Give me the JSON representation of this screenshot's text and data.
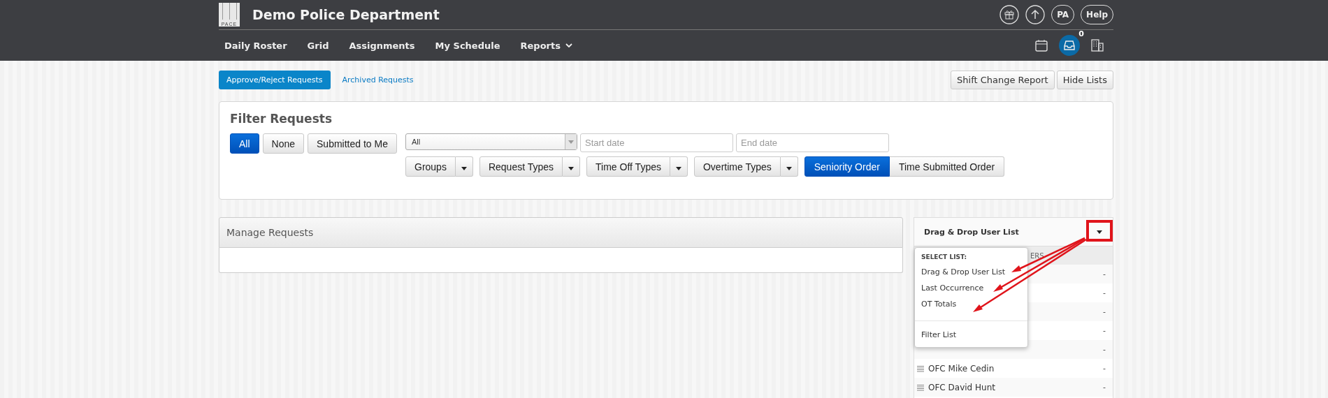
{
  "header": {
    "logo": "PACE",
    "title": "Demo Police Department",
    "circle_buttons": [
      {
        "kind": "gift"
      },
      {
        "kind": "upload"
      },
      {
        "kind": "text",
        "label": "PA"
      },
      {
        "kind": "text",
        "label": "Help"
      }
    ],
    "nav": [
      {
        "label": "Daily Roster",
        "has_menu": false
      },
      {
        "label": "Grid",
        "has_menu": false
      },
      {
        "label": "Assignments",
        "has_menu": false
      },
      {
        "label": "My Schedule",
        "has_menu": false
      },
      {
        "label": "Reports",
        "has_menu": true
      }
    ],
    "nav_icons": [
      {
        "kind": "calendar",
        "selected": false
      },
      {
        "kind": "inbox",
        "selected": true,
        "badge": "0"
      },
      {
        "kind": "building",
        "selected": false
      }
    ]
  },
  "tabs": [
    {
      "label": "Approve/Reject Requests",
      "selected": true
    },
    {
      "label": "Archived Requests",
      "selected": false
    }
  ],
  "top_buttons": [
    "Shift Change Report",
    "Hide Lists"
  ],
  "filter": {
    "title": "Filter Requests",
    "quick": [
      {
        "label": "All",
        "selected": true
      },
      {
        "label": "None",
        "selected": false
      },
      {
        "label": "Submitted to Me",
        "selected": false
      }
    ],
    "select_value": "All",
    "start_placeholder": "Start date",
    "end_placeholder": "End date",
    "dropdowns": [
      "Groups",
      "Request Types",
      "Time Off Types",
      "Overtime Types"
    ],
    "order": [
      {
        "label": "Seniority Order",
        "selected": true
      },
      {
        "label": "Time Submitted Order",
        "selected": false
      }
    ]
  },
  "manage": {
    "title": "Manage Requests"
  },
  "user_list": {
    "title": "Drag & Drop User List",
    "column_1": "ERS",
    "rows": [
      {
        "value": "-"
      },
      {
        "value": "-"
      },
      {
        "value": "-"
      },
      {
        "value": "-"
      },
      {
        "value": "-"
      },
      {
        "name": "OFC Mike Cedin",
        "value": "-"
      },
      {
        "name": "OFC David Hunt",
        "value": "-"
      }
    ],
    "menu": {
      "heading": "SELECT LIST:",
      "items": [
        "Drag & Drop User List",
        "Last Occurrence",
        "OT Totals"
      ],
      "footer_item": "Filter List"
    }
  }
}
